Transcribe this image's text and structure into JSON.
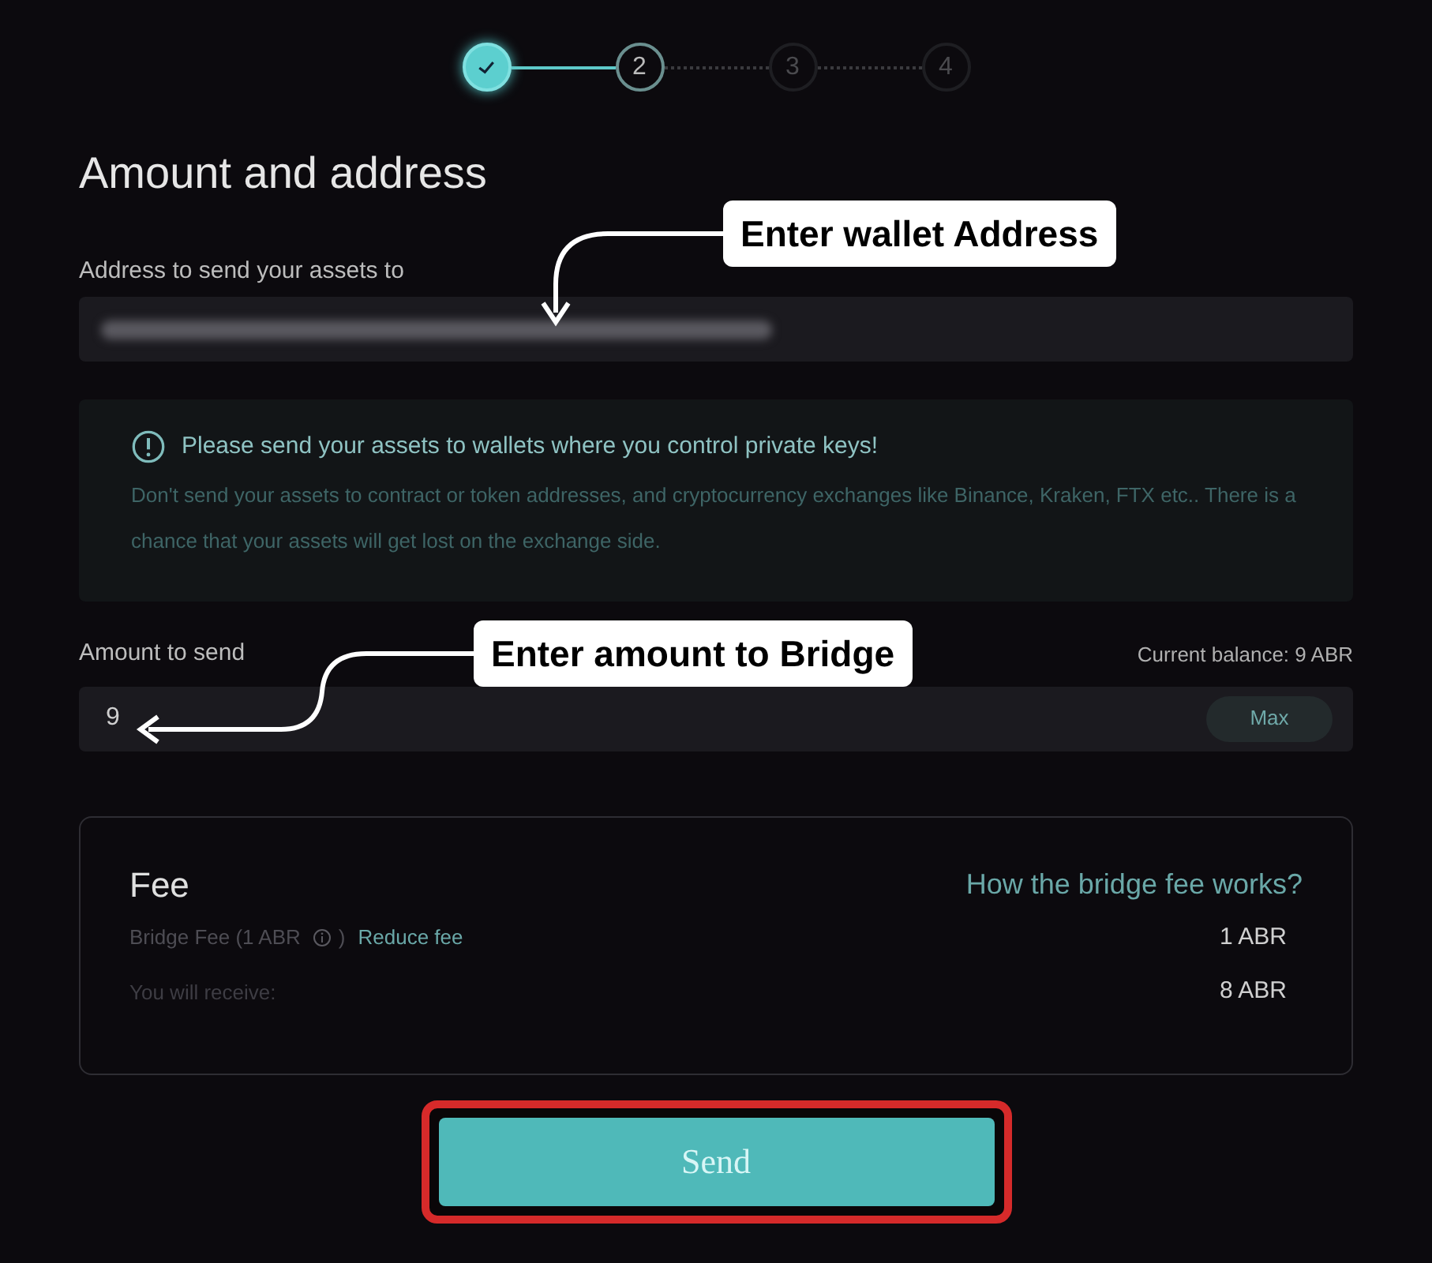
{
  "steps": [
    {
      "done": true,
      "selected": false
    },
    {
      "label": "2",
      "done": false,
      "selected": true
    },
    {
      "label": "3",
      "done": false,
      "selected": false
    },
    {
      "label": "4",
      "done": false,
      "selected": false
    }
  ],
  "heading": "Amount and address",
  "address": {
    "label": "Address to send your assets to",
    "redacted": true
  },
  "warning": {
    "title": "Please send your assets to wallets where you control private keys!",
    "body": "Don't send your assets to contract or token addresses, and cryptocurrency exchanges like Binance, Kraken, FTX etc.. There is a chance that your assets will get lost on the exchange side."
  },
  "amount": {
    "label": "Amount to send",
    "balance": "Current balance: 9 ABR",
    "value": "9",
    "max_button": "Max"
  },
  "fee": {
    "title": "Fee",
    "help_link": "How the bridge fee works?",
    "bridge_fee_label": "Bridge Fee (1 ABR",
    "bridge_fee_close": ")",
    "reduce_link": "Reduce fee",
    "bridge_fee_value": "1 ABR",
    "receive_label": "You will receive:",
    "receive_value": "8 ABR"
  },
  "send_button": {
    "label": "Send",
    "highlighted": true
  },
  "callouts": [
    {
      "text": "Enter wallet Address"
    },
    {
      "text": "Enter amount to Bridge"
    }
  ]
}
